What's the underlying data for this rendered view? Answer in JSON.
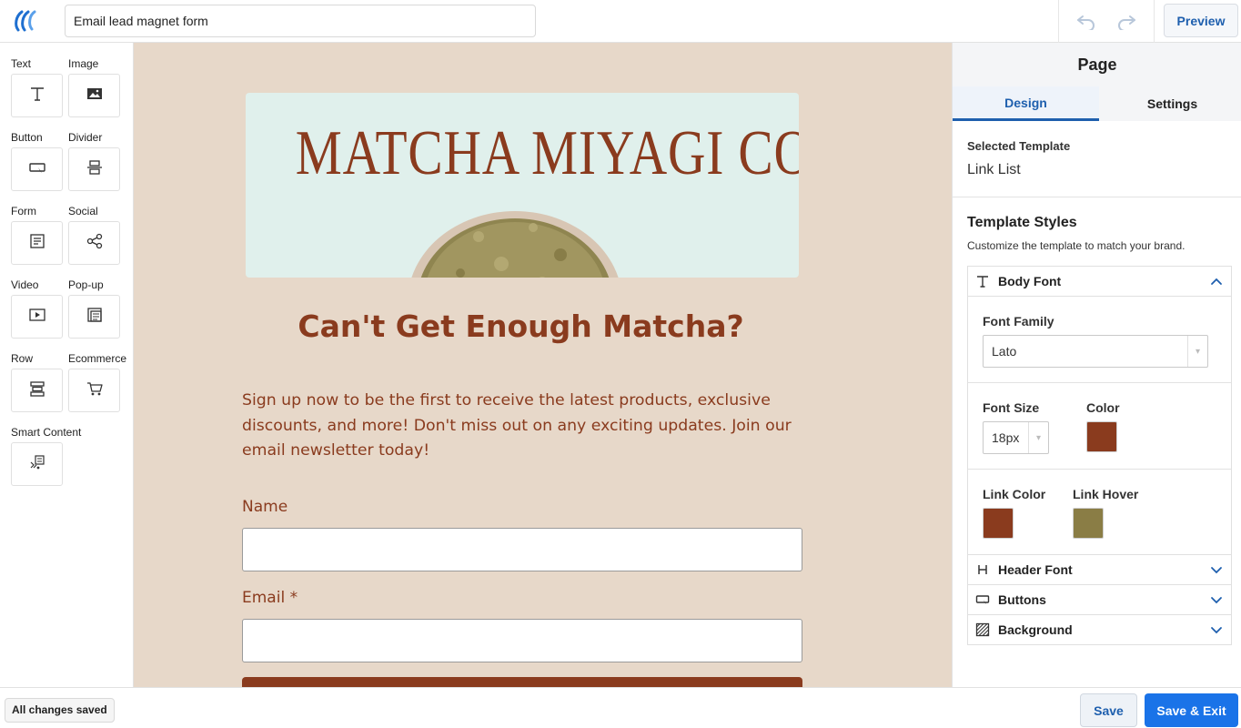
{
  "header": {
    "title_value": "Email lead magnet form",
    "preview_label": "Preview"
  },
  "palette": {
    "items": [
      {
        "label": "Text",
        "icon": "text-icon"
      },
      {
        "label": "Image",
        "icon": "image-icon"
      },
      {
        "label": "Button",
        "icon": "button-icon"
      },
      {
        "label": "Divider",
        "icon": "divider-icon"
      },
      {
        "label": "Form",
        "icon": "form-icon"
      },
      {
        "label": "Social",
        "icon": "share-icon"
      },
      {
        "label": "Video",
        "icon": "video-icon"
      },
      {
        "label": "Pop-up",
        "icon": "popup-icon"
      },
      {
        "label": "Row",
        "icon": "row-icon"
      },
      {
        "label": "Ecommerce",
        "icon": "cart-icon"
      },
      {
        "label": "Smart Content",
        "icon": "smart-content-icon"
      }
    ]
  },
  "canvas": {
    "hero_title": "MATCHA MIYAGI CO",
    "headline": "Can't Get Enough Matcha?",
    "description": "Sign up now to be the first to receive the latest products, exclusive discounts, and more! Don't miss out on any exciting updates. Join our email newsletter today!",
    "name_label": "Name",
    "email_label": "Email *",
    "name_value": "",
    "email_value": "",
    "background_color": "#e7d8c9",
    "text_color": "#8a3b1e"
  },
  "panel": {
    "title": "Page",
    "tabs": [
      {
        "label": "Design",
        "active": true
      },
      {
        "label": "Settings",
        "active": false
      }
    ],
    "selected_template_label": "Selected Template",
    "selected_template_value": "Link List",
    "template_styles_title": "Template Styles",
    "template_styles_subtitle": "Customize the template to match your brand.",
    "body_font": {
      "label": "Body Font",
      "expanded": true,
      "font_family_label": "Font Family",
      "font_family_value": "Lato",
      "font_size_label": "Font Size",
      "font_size_value": "18px",
      "color_label": "Color",
      "color_value": "#8a3b1e",
      "link_color_label": "Link Color",
      "link_color_value": "#8a3b1e",
      "link_hover_label": "Link Hover",
      "link_hover_value": "#8a7d45"
    },
    "sections": [
      {
        "label": "Header Font",
        "icon": "header-font-icon",
        "expanded": false
      },
      {
        "label": "Buttons",
        "icon": "buttons-icon",
        "expanded": false
      },
      {
        "label": "Background",
        "icon": "background-icon",
        "expanded": false
      }
    ]
  },
  "footer": {
    "status": "All changes saved",
    "save_label": "Save",
    "save_exit_label": "Save & Exit"
  },
  "colors": {
    "accent": "#1e5fae",
    "primary_button": "#1a73e8"
  }
}
